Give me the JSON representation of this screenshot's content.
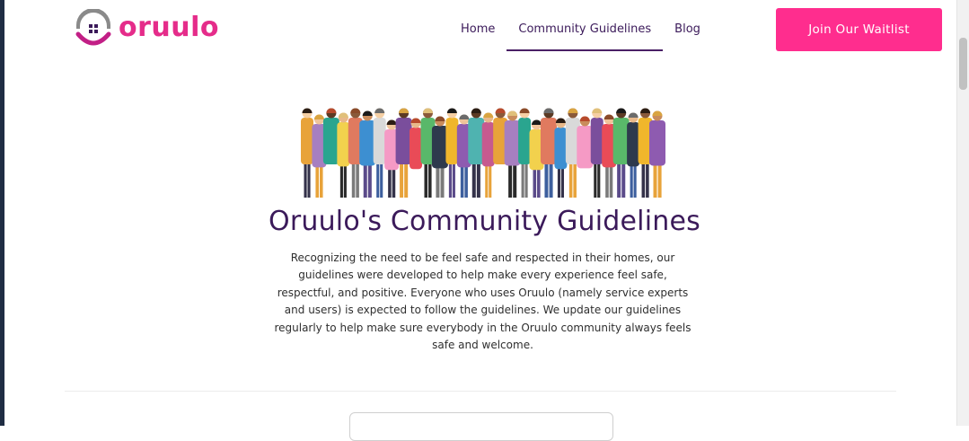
{
  "brand": {
    "name": "oruulo",
    "color": "#e52c8a",
    "logo_icon": "house-smile-icon"
  },
  "nav": {
    "items": [
      {
        "label": "Home",
        "active": false
      },
      {
        "label": "Community Guidelines",
        "active": true
      },
      {
        "label": "Blog",
        "active": false
      }
    ],
    "cta_label": "Join Our Waitlist",
    "cta_color": "#ff2d8e"
  },
  "hero": {
    "illustration": "diverse-crowd-illustration",
    "title": "Oruulo's Community Guidelines",
    "intro": "Recognizing the need to be feel safe and respected in their homes, our guidelines were developed to help make every experience feel safe, respectful, and positive. Everyone who uses Oruulo (namely service experts and users) is expected to follow the guidelines. We update our guidelines regularly to help make sure everybody in the Oruulo community always feels safe and welcome."
  },
  "colors": {
    "text_primary": "#3b1a5a",
    "accent": "#ff2d8e"
  }
}
